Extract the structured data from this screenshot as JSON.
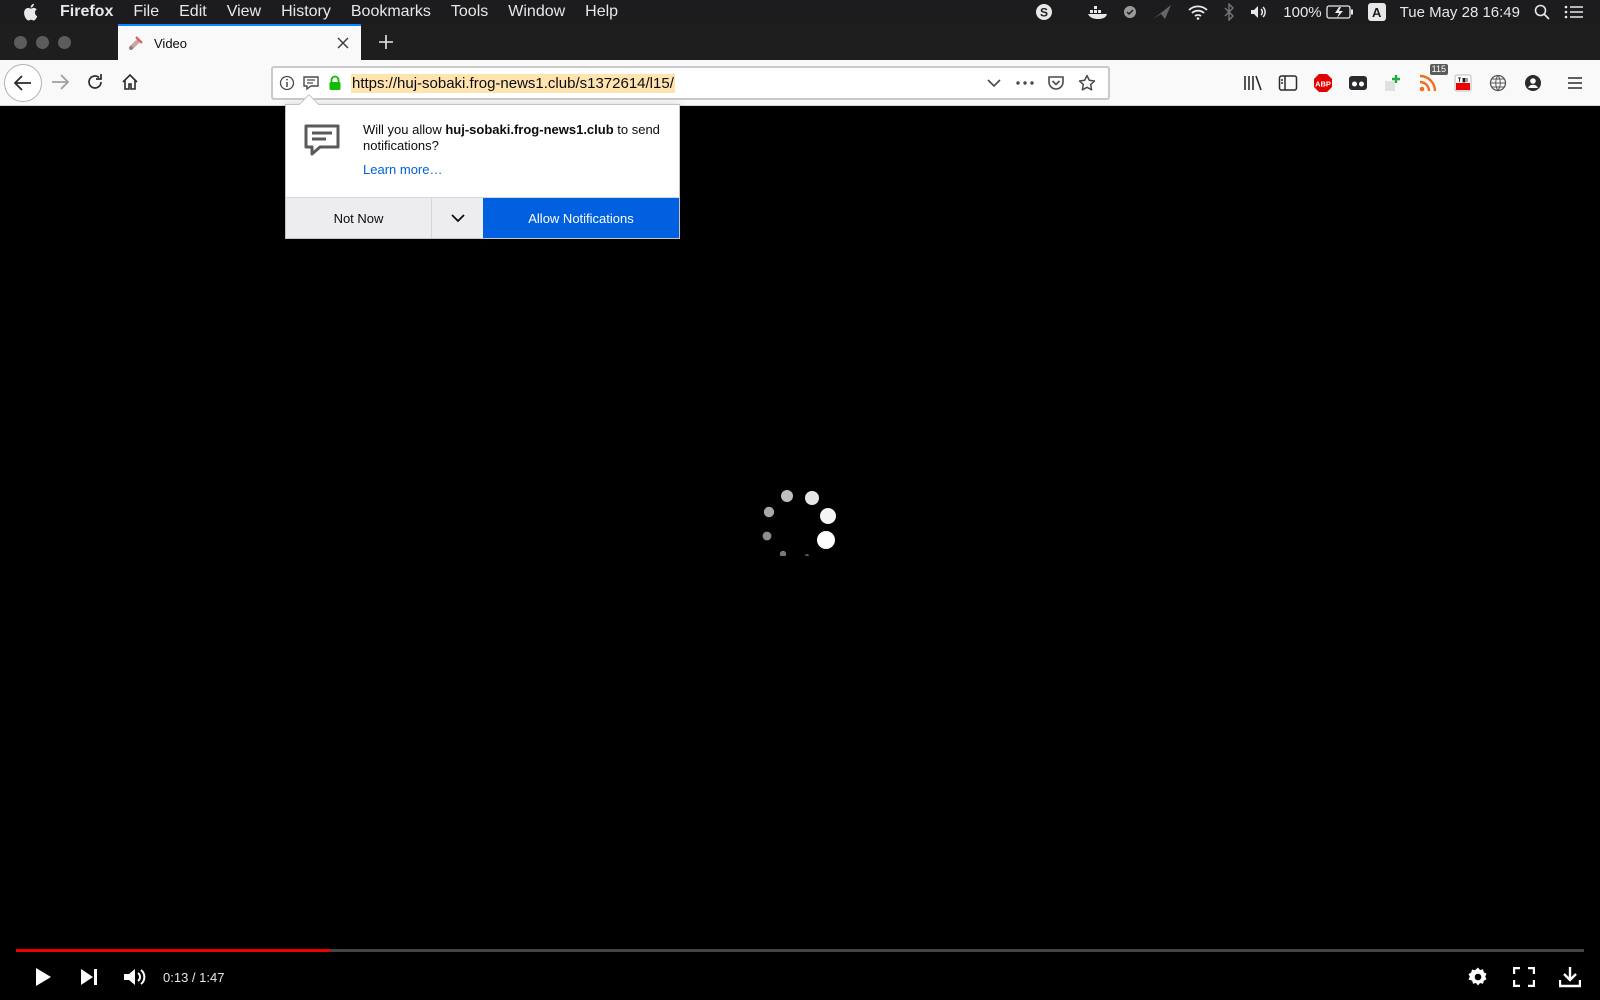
{
  "menubar": {
    "app_name": "Firefox",
    "menus": [
      "File",
      "Edit",
      "View",
      "History",
      "Bookmarks",
      "Tools",
      "Window",
      "Help"
    ],
    "battery": "100%",
    "input_source": "A",
    "datetime": "Tue May 28  16:49"
  },
  "tab": {
    "title": "Video"
  },
  "urlbar": {
    "url": "https://huj-sobaki.frog-news1.club/s1372614/l15/"
  },
  "toolbar": {
    "rss_badge": "115",
    "abp_label": "ABP"
  },
  "doorhanger": {
    "message_prefix": "Will you allow ",
    "site": "huj-sobaki.frog-news1.club",
    "message_suffix": " to send notifications?",
    "learn_more": "Learn more…",
    "not_now": "Not Now",
    "allow": "Allow Notifications"
  },
  "player": {
    "time": "0:13 / 1:47",
    "progress_fraction": 0.2,
    "progress_color": "#ee0000"
  },
  "colors": {
    "accent": "#0060df",
    "tab_highlight": "#0a84ff",
    "lock_green": "#12bc00"
  }
}
